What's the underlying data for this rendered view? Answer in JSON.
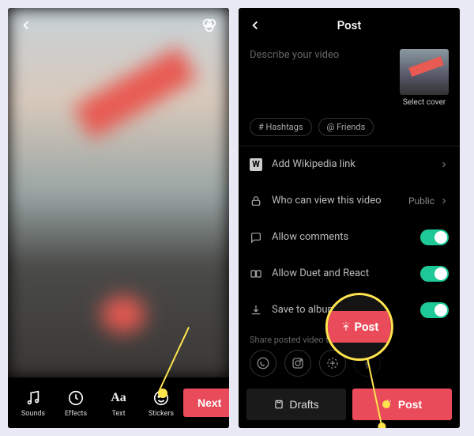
{
  "colors": {
    "accent": "#e94b5a",
    "toggle_on": "#1ec997",
    "highlight": "#ffe44d"
  },
  "editor": {
    "back_icon": "chevron-left",
    "filter_icon": "filters",
    "tools": [
      {
        "key": "sounds",
        "label": "Sounds",
        "icon": "music-note"
      },
      {
        "key": "effects",
        "label": "Effects",
        "icon": "clock-sparkle"
      },
      {
        "key": "text",
        "label": "Text",
        "icon": "text-aa"
      },
      {
        "key": "stickers",
        "label": "Stickers",
        "icon": "smiley"
      }
    ],
    "next_label": "Next"
  },
  "post": {
    "header_title": "Post",
    "description_placeholder": "Describe your video",
    "cover_label": "Select cover",
    "tag_buttons": [
      {
        "key": "hashtags",
        "label": "# Hashtags"
      },
      {
        "key": "friends",
        "label": "@ Friends"
      }
    ],
    "options": [
      {
        "key": "wiki",
        "icon": "wikipedia",
        "label": "Add Wikipedia link",
        "right_type": "chevron"
      },
      {
        "key": "privacy",
        "icon": "lock",
        "label": "Who can view this video",
        "right_type": "value_chevron",
        "value": "Public"
      },
      {
        "key": "comments",
        "icon": "comment",
        "label": "Allow comments",
        "right_type": "toggle",
        "on": true
      },
      {
        "key": "duet",
        "icon": "duet",
        "label": "Allow Duet and React",
        "right_type": "toggle",
        "on": true
      },
      {
        "key": "save",
        "icon": "download",
        "label": "Save to album",
        "right_type": "toggle",
        "on": true
      }
    ],
    "share_label": "Share posted video to:",
    "share_targets": [
      {
        "key": "whatsapp",
        "icon": "whatsapp"
      },
      {
        "key": "instagram",
        "icon": "instagram"
      },
      {
        "key": "more",
        "icon": "plus-sparkle"
      },
      {
        "key": "facebook",
        "icon": "facebook"
      }
    ],
    "drafts_label": "Drafts",
    "post_label": "Post",
    "callout_label": "Post"
  }
}
